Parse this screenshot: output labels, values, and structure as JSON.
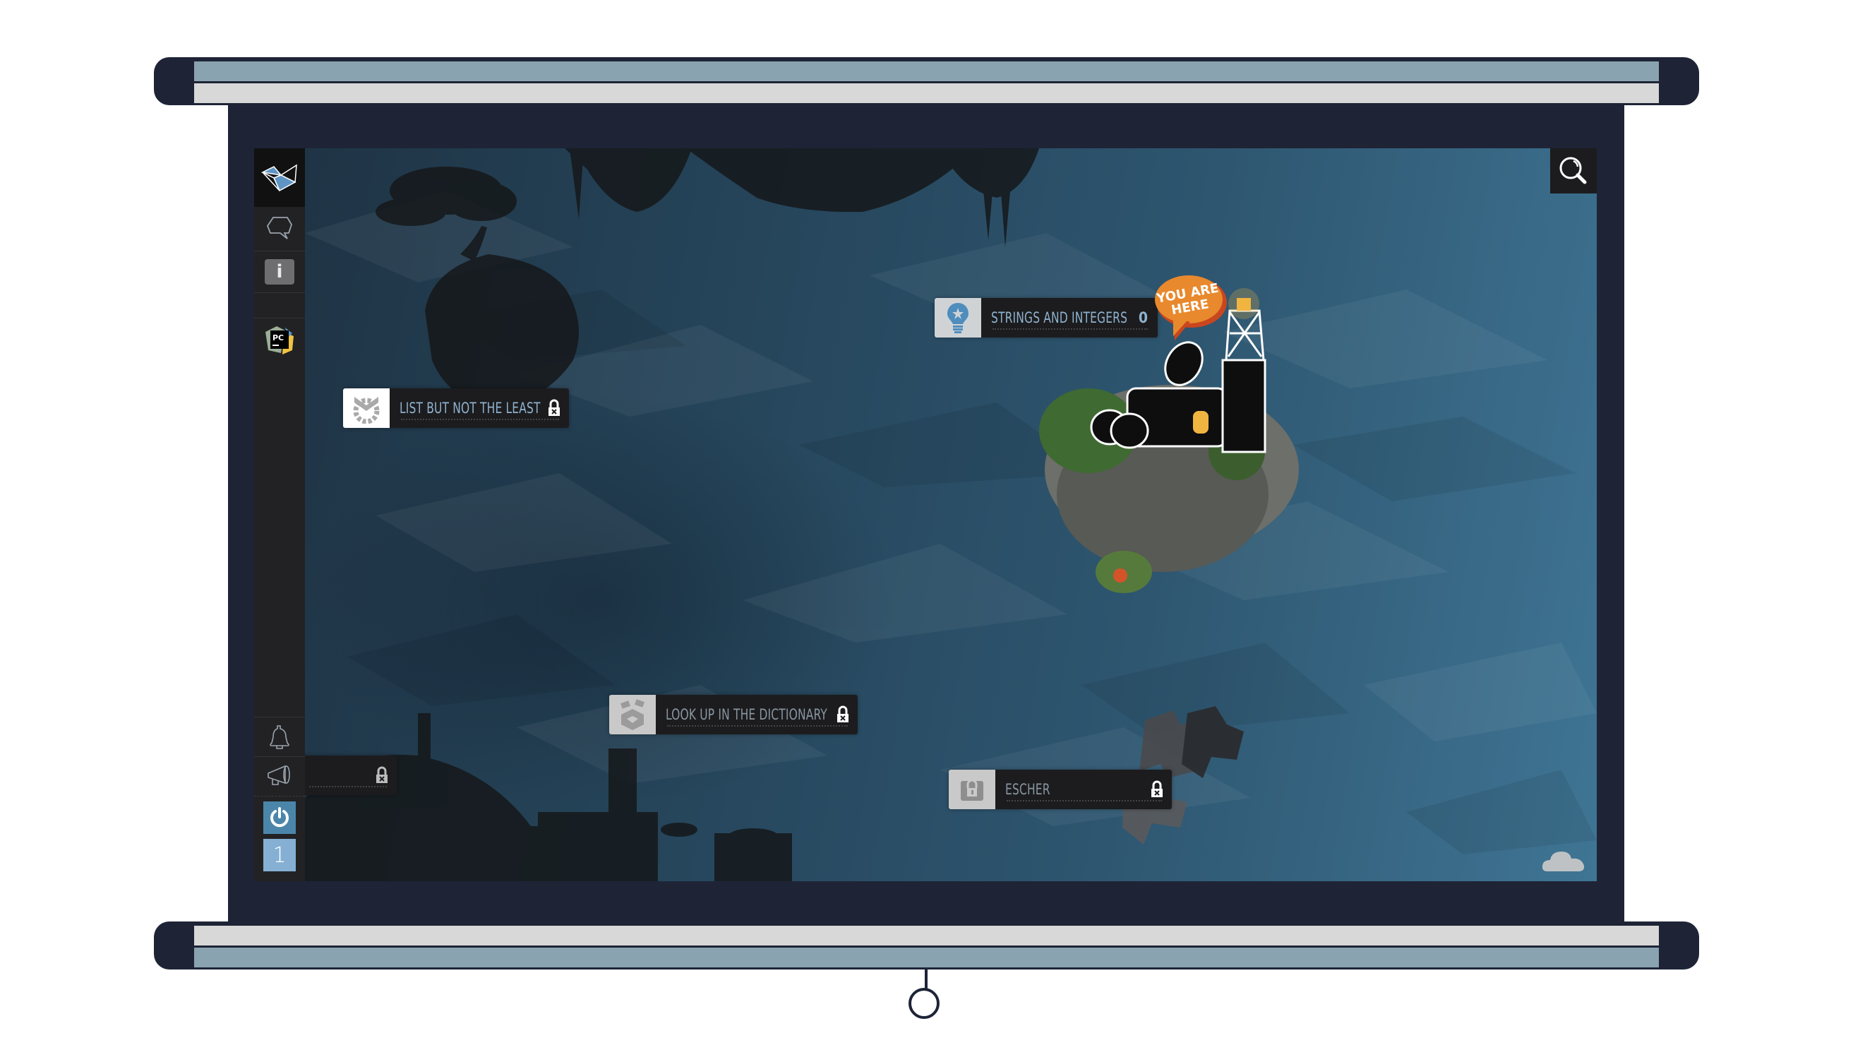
{
  "sidebar": {
    "logo_icon": "origami-fox-logo-icon",
    "items": [
      {
        "name": "chat",
        "icon": "speech-bubble-icon"
      },
      {
        "name": "info",
        "icon": "info-icon",
        "label": "i"
      },
      {
        "name": "ide",
        "icon": "pycharm-icon",
        "label": "PC"
      },
      {
        "name": "notifications",
        "icon": "bell-icon"
      },
      {
        "name": "announcements",
        "icon": "megaphone-icon"
      },
      {
        "name": "power",
        "icon": "power-icon"
      },
      {
        "name": "level",
        "label": "1"
      }
    ]
  },
  "map": {
    "search_icon": "search-icon",
    "cloud_icon": "cloud-icon",
    "you_are_here": {
      "line1": "YOU ARE",
      "line2": "HERE"
    },
    "levels": [
      {
        "title": "STRINGS AND INTEGERS",
        "score": "0",
        "icon": "lightbulb-icon",
        "locked": false,
        "current": true
      },
      {
        "title": "LIST BUT NOT THE LEAST",
        "icon": "gear-shield-icon",
        "locked": true
      },
      {
        "title": "LOOK UP IN THE DICTIONARY",
        "icon": "dictionary-badge-icon",
        "locked": true
      },
      {
        "title": "ESCHER",
        "icon": "treasure-chest-icon",
        "locked": true
      },
      {
        "title": "",
        "locked": true
      }
    ]
  },
  "colors": {
    "frame": "#1e2436",
    "roller_blue": "#8aa3b0",
    "roller_gray": "#d8d8d8",
    "sidebar_bg": "#222224",
    "tag_text": "#8fb2cf",
    "you_are_here": "#e8892d",
    "power_button": "#4b86aa",
    "level_badge": "#85b0d4"
  }
}
